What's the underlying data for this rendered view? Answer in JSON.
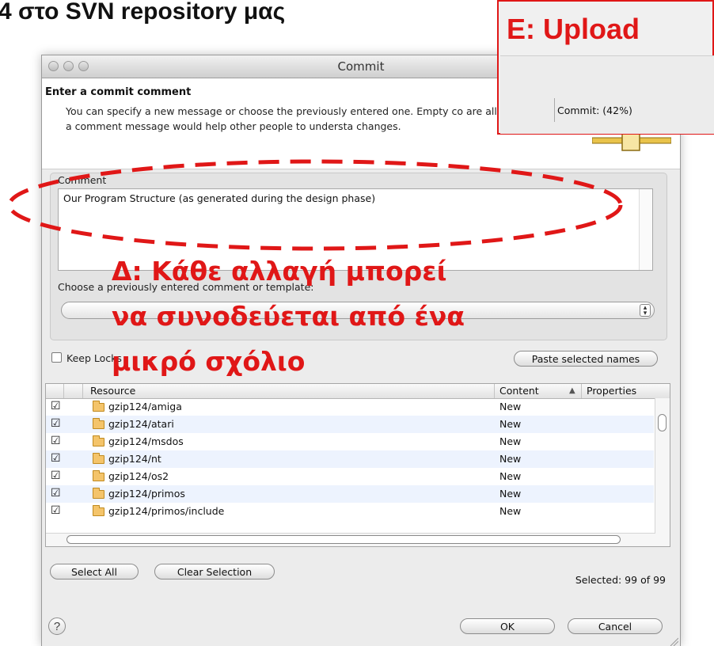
{
  "slide": {
    "title": "4 στο SVN repository μας"
  },
  "dialog": {
    "title": "Commit",
    "header_title": "Enter a commit comment",
    "header_description": "You can specify a new message or choose the previously entered one. Empty co are allowed, but filling a comment message would help other people to understa changes.",
    "comment_label": "Comment",
    "comment_text": "Our Program Structure (as generated during the design phase)",
    "choose_label": "Choose a previously entered comment or template:",
    "keep_locks_label": "Keep Locks",
    "paste_button": "Paste selected names",
    "table": {
      "columns": [
        "Resource",
        "Content",
        "Properties"
      ],
      "rows": [
        {
          "checked": true,
          "resource": "gzip124/amiga",
          "content": "New"
        },
        {
          "checked": true,
          "resource": "gzip124/atari",
          "content": "New"
        },
        {
          "checked": true,
          "resource": "gzip124/msdos",
          "content": "New"
        },
        {
          "checked": true,
          "resource": "gzip124/nt",
          "content": "New"
        },
        {
          "checked": true,
          "resource": "gzip124/os2",
          "content": "New"
        },
        {
          "checked": true,
          "resource": "gzip124/primos",
          "content": "New"
        },
        {
          "checked": true,
          "resource": "gzip124/primos/include",
          "content": "New"
        }
      ]
    },
    "select_all": "Select All",
    "clear_selection": "Clear Selection",
    "selected_count": "Selected: 99 of 99",
    "help_icon": "?",
    "ok": "OK",
    "cancel": "Cancel"
  },
  "upload": {
    "title": "E: Upload",
    "status": "Commit: (42%)",
    "progress_fraction": 0.42
  },
  "annotation": {
    "lines": [
      "Δ: Κάθε αλλαγή μπορεί",
      "να συνοδεύεται από ένα",
      "μικρό σχόλιο"
    ]
  },
  "colors": {
    "annotation": "#e01717",
    "dialog_bg": "#ececec"
  }
}
